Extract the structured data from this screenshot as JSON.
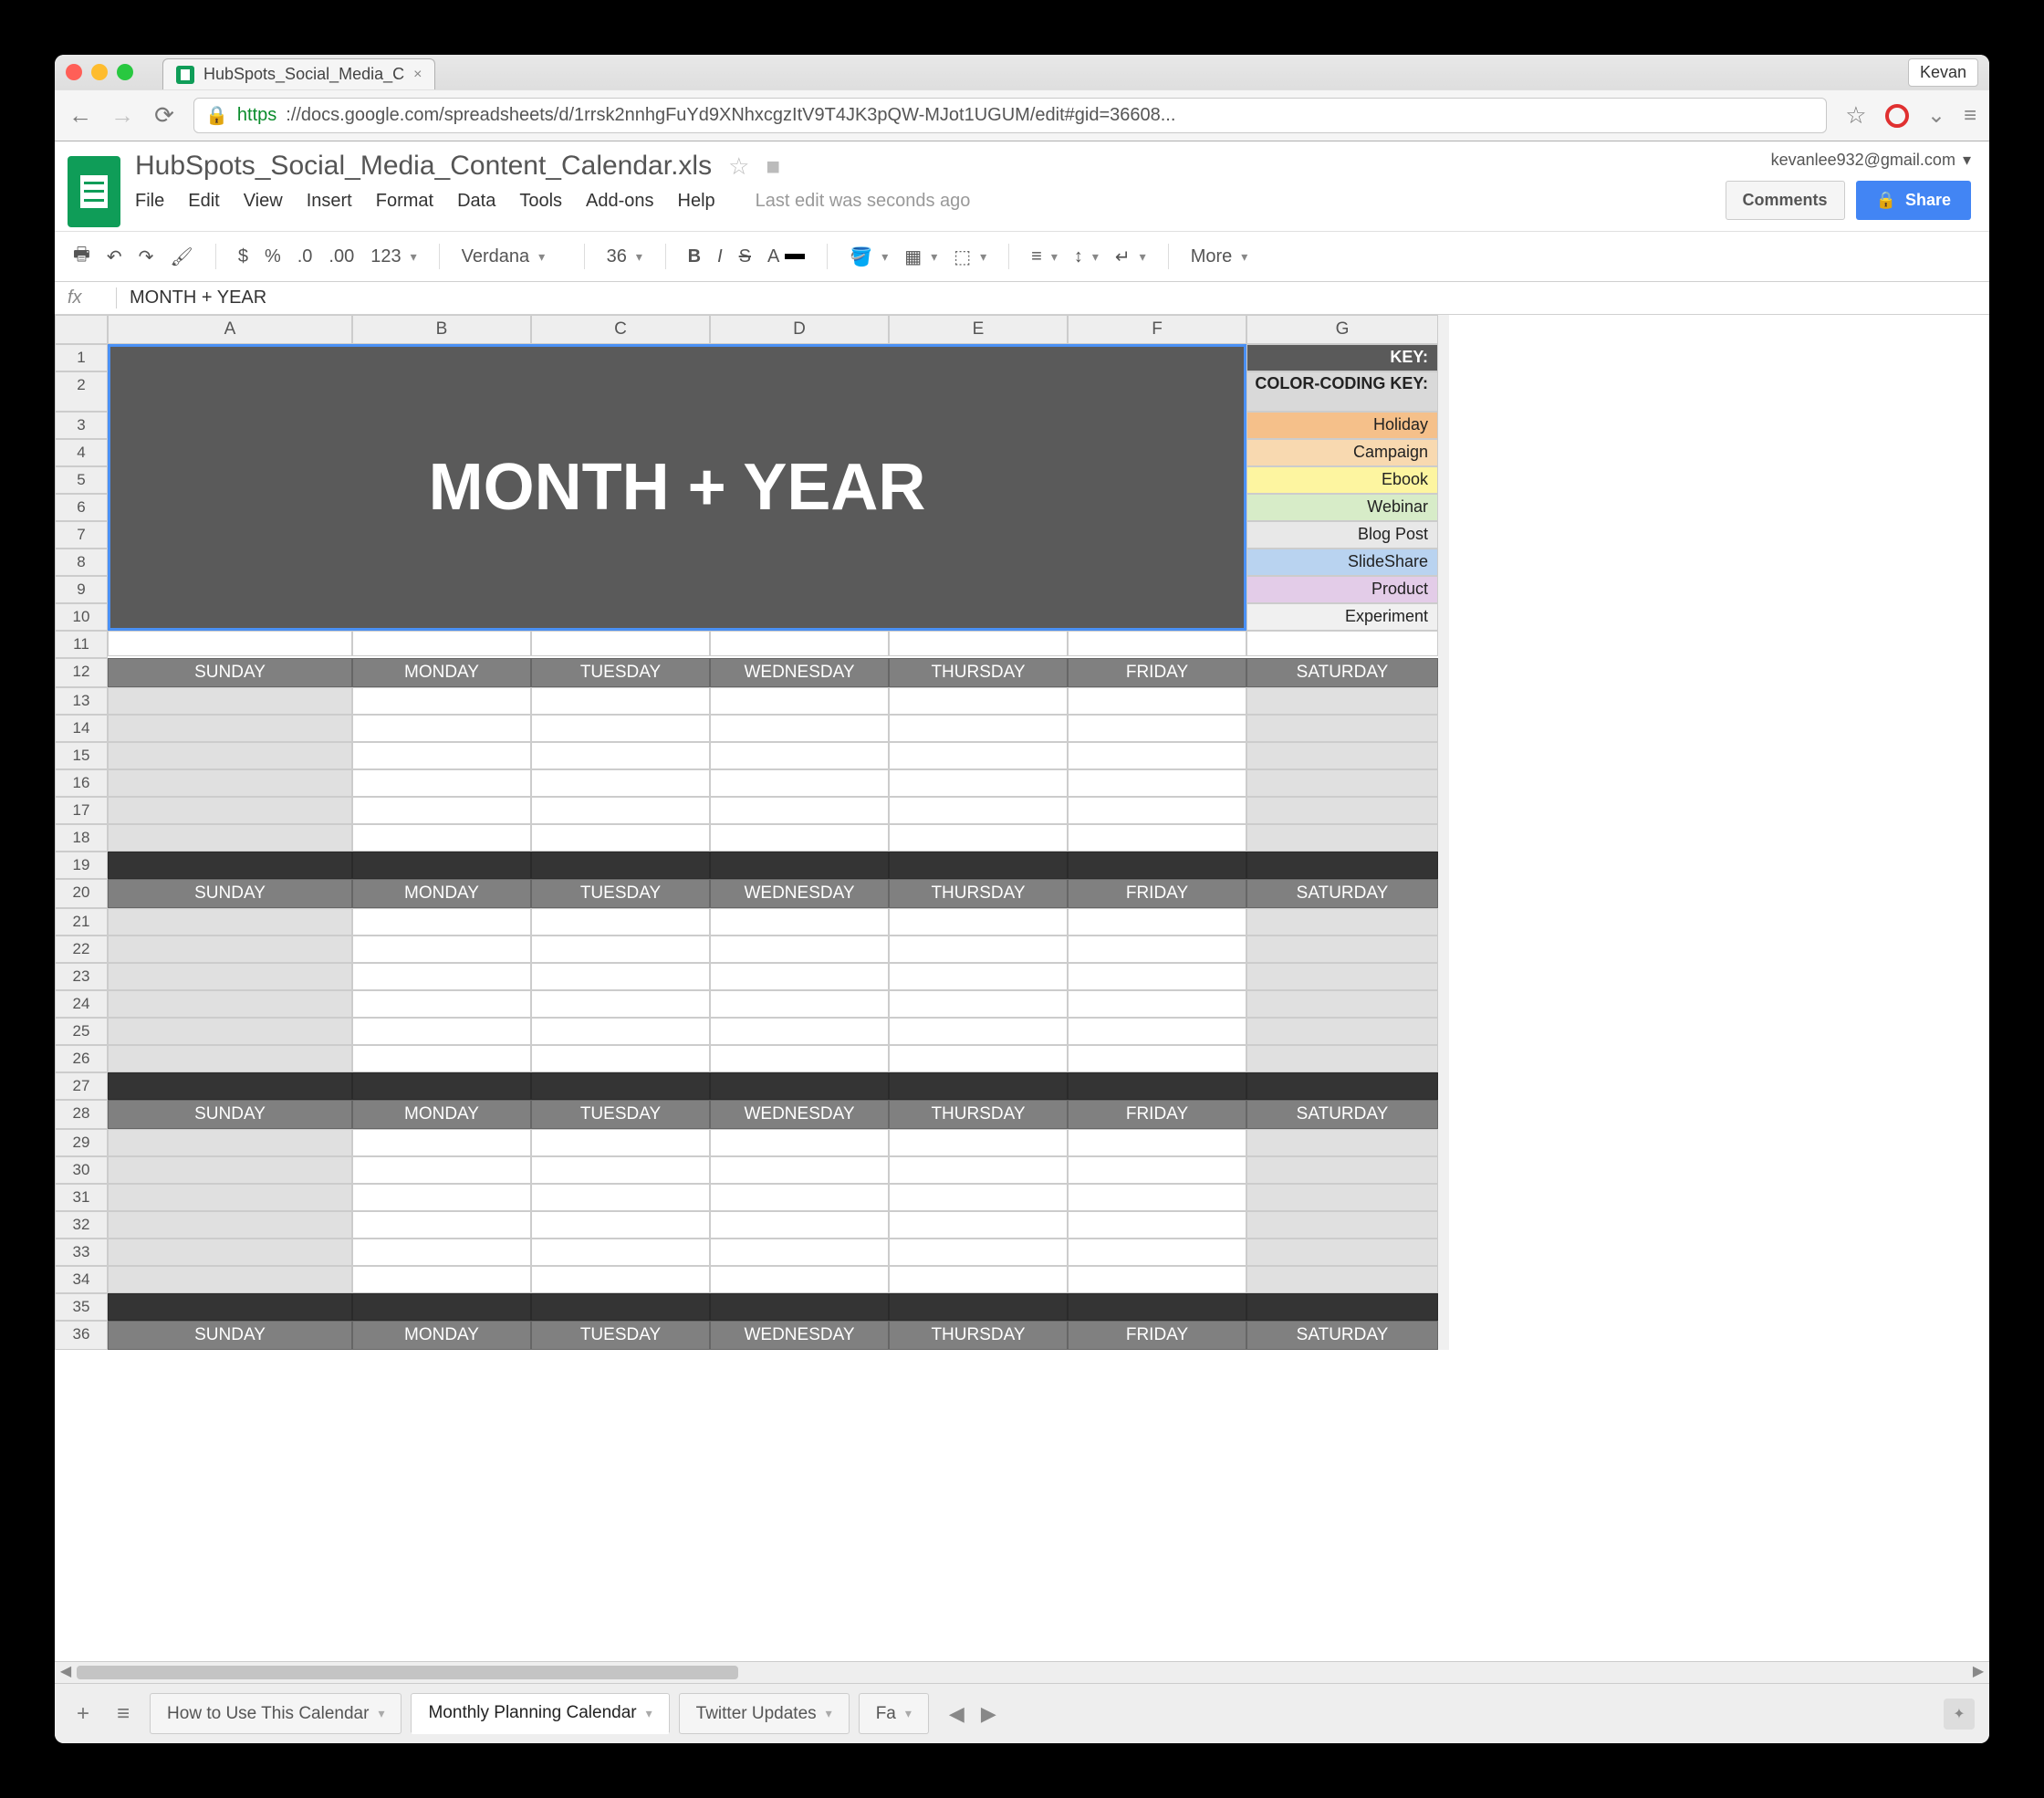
{
  "window": {
    "user_chip": "Kevan"
  },
  "browser": {
    "tab_title": "HubSpots_Social_Media_C",
    "url_scheme": "https",
    "url_display": "://docs.google.com/spreadsheets/d/1rrsk2nnhgFuYd9XNhxcgzItV9T4JK3pQW-MJot1UGUM/edit#gid=36608..."
  },
  "docs": {
    "title": "HubSpots_Social_Media_Content_Calendar.xls",
    "menus": [
      "File",
      "Edit",
      "View",
      "Insert",
      "Format",
      "Data",
      "Tools",
      "Add-ons",
      "Help"
    ],
    "status": "Last edit was seconds ago",
    "account_email": "kevanlee932@gmail.com",
    "comments_label": "Comments",
    "share_label": "Share"
  },
  "toolbar": {
    "font": "Verdana",
    "font_size": "36",
    "more_label": "More"
  },
  "formula_bar": {
    "value": "MONTH + YEAR"
  },
  "columns": [
    "A",
    "B",
    "C",
    "D",
    "E",
    "F",
    "G"
  ],
  "rows": [
    1,
    2,
    3,
    4,
    5,
    6,
    7,
    8,
    9,
    10,
    11,
    12,
    13,
    14,
    15,
    16,
    17,
    18,
    19,
    20,
    21,
    22,
    23,
    24,
    25,
    26,
    27,
    28,
    29,
    30,
    31,
    32,
    33,
    34,
    35,
    36
  ],
  "big_title": "MONTH + YEAR",
  "key": {
    "header": "KEY:",
    "subheader": "COLOR-CODING KEY:",
    "items": [
      {
        "label": "Holiday",
        "class": "c-holiday"
      },
      {
        "label": "Campaign",
        "class": "c-campaign"
      },
      {
        "label": "Ebook",
        "class": "c-ebook"
      },
      {
        "label": "Webinar",
        "class": "c-webinar"
      },
      {
        "label": "Blog Post",
        "class": "c-blog"
      },
      {
        "label": "SlideShare",
        "class": "c-slideshare"
      },
      {
        "label": "Product",
        "class": "c-product"
      },
      {
        "label": "Experiment",
        "class": "c-experiment"
      }
    ]
  },
  "days": [
    "SUNDAY",
    "MONDAY",
    "TUESDAY",
    "WEDNESDAY",
    "THURSDAY",
    "FRIDAY",
    "SATURDAY"
  ],
  "sheet_tabs": {
    "items": [
      "How to Use This Calendar",
      "Monthly Planning Calendar",
      "Twitter Updates",
      "Fa"
    ],
    "active_index": 1
  }
}
